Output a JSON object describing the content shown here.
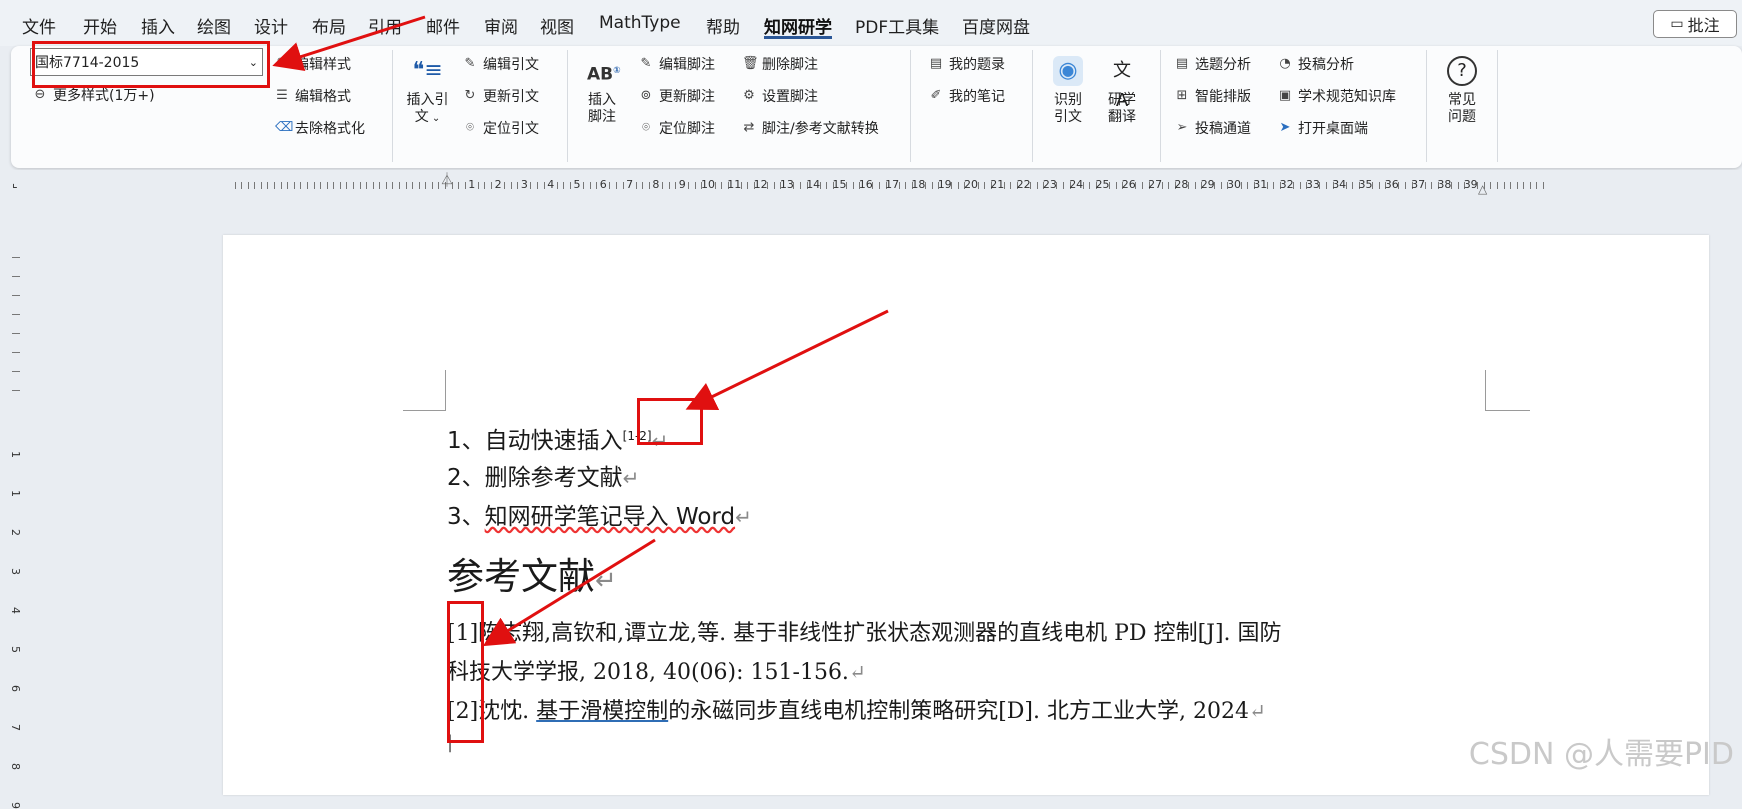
{
  "menu": {
    "items": [
      "文件",
      "开始",
      "插入",
      "绘图",
      "设计",
      "布局",
      "引用",
      "邮件",
      "审阅",
      "视图",
      "MathType",
      "帮助",
      "知网研学",
      "PDF工具集",
      "百度网盘"
    ],
    "active": "知网研学",
    "comment_label": "批注"
  },
  "ribbon": {
    "style_select_value": "国标7714-2015",
    "more_styles": "更多样式(1万+)",
    "edit_style": "编辑样式",
    "edit_format": "编辑格式",
    "remove_format": "去除格式化",
    "insert_citation": [
      "插入引",
      "文"
    ],
    "edit_citation": "编辑引文",
    "update_citation": "更新引文",
    "locate_citation": "定位引文",
    "insert_footnote": [
      "插入",
      "脚注"
    ],
    "edit_footnote": "编辑脚注",
    "delete_footnote": "删除脚注",
    "update_footnote": "更新脚注",
    "set_footnote": "设置脚注",
    "locate_footnote": "定位脚注",
    "footnote_convert": "脚注/参考文献转换",
    "my_records": "我的题录",
    "my_notes": "我的笔记",
    "recognize_citation": [
      "识别",
      "引文"
    ],
    "research_translate": [
      "研学",
      "翻译"
    ],
    "topic_analysis": "选题分析",
    "submission_analysis": "投稿分析",
    "smart_layout": "智能排版",
    "academic_kb": "学术规范知识库",
    "submission_channel": "投稿通道",
    "open_desktop": "打开桌面端",
    "faq": [
      "常见",
      "问题"
    ]
  },
  "ruler": {
    "numbers": [
      "1",
      "2",
      "3",
      "4",
      "5",
      "6",
      "7",
      "8",
      "9",
      "10",
      "11",
      "12",
      "13",
      "14",
      "15",
      "16",
      "17",
      "18",
      "19",
      "20",
      "21",
      "22",
      "23",
      "24",
      "25",
      "26",
      "27",
      "28",
      "29",
      "30",
      "31",
      "32",
      "33",
      "34",
      "35",
      "36",
      "37",
      "38",
      "39"
    ],
    "vnumbers": [
      "1",
      "1",
      "2",
      "3",
      "4",
      "5",
      "6",
      "7",
      "8",
      "9"
    ]
  },
  "document": {
    "list": [
      {
        "num": "1、",
        "text": "自动快速插入",
        "citation": "[1-2]"
      },
      {
        "num": "2、",
        "text": "删除参考文献"
      },
      {
        "num": "3、",
        "text": "知网研学笔记导入 Word"
      }
    ],
    "heading": "参考文献",
    "refs": [
      {
        "line1_num": "[1]",
        "line1": "陈志翔,高钦和,谭立龙,等.  基于非线性扩张状态观测器的直线电机 PD 控制[J].  国防",
        "line2": "科技大学学报, 2018, 40(06): 151-156."
      },
      {
        "line1_num": "[2]",
        "prefix": "沈忱.  ",
        "link": "基于滑模控制",
        "suffix": "的永磁同步直线电机控制策略研究[D].  北方工业大学, 2024"
      }
    ],
    "para_mark": "↵"
  },
  "watermark": "CSDN @人需要PID"
}
